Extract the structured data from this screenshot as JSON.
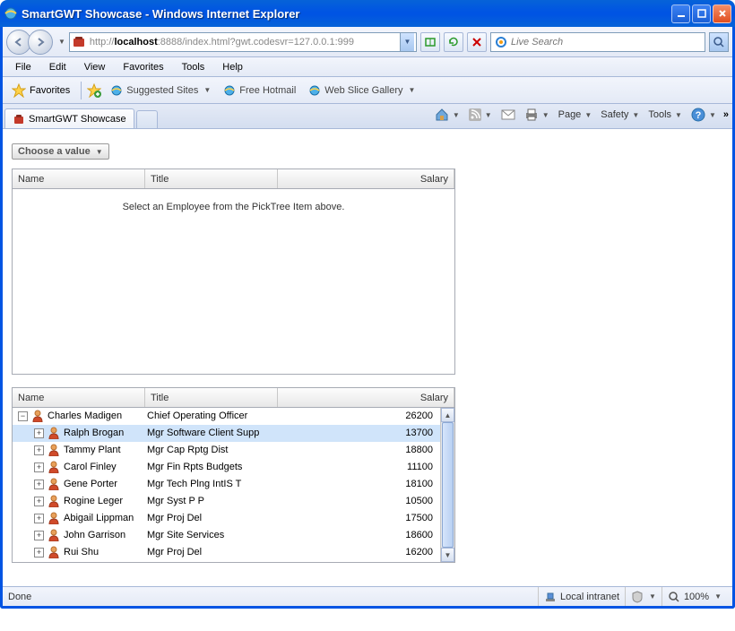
{
  "titlebar": {
    "text": "SmartGWT Showcase - Windows Internet Explorer"
  },
  "address": {
    "protocol": "http://",
    "host": "localhost",
    "rest": ":8888/index.html?gwt.codesvr=127.0.0.1:999"
  },
  "search": {
    "placeholder": "Live Search"
  },
  "menubar": [
    "File",
    "Edit",
    "View",
    "Favorites",
    "Tools",
    "Help"
  ],
  "favbar": {
    "favorites": "Favorites",
    "links": [
      "Suggested Sites",
      "Free Hotmail",
      "Web Slice Gallery"
    ]
  },
  "tab": {
    "label": "SmartGWT Showcase"
  },
  "tabtools": {
    "page": "Page",
    "safety": "Safety",
    "tools": "Tools"
  },
  "picker": {
    "label": "Choose a value"
  },
  "grid1": {
    "headers": {
      "name": "Name",
      "title": "Title",
      "salary": "Salary"
    },
    "empty": "Select an Employee from the PickTree Item above."
  },
  "grid2": {
    "headers": {
      "name": "Name",
      "title": "Title",
      "salary": "Salary"
    },
    "rows": [
      {
        "indent": 0,
        "expanded": true,
        "name": "Charles Madigen",
        "title": "Chief Operating Officer",
        "salary": "26200",
        "selected": false
      },
      {
        "indent": 1,
        "expanded": false,
        "name": "Ralph Brogan",
        "title": "Mgr Software Client Supp",
        "salary": "13700",
        "selected": true
      },
      {
        "indent": 1,
        "expanded": false,
        "name": "Tammy Plant",
        "title": "Mgr Cap Rptg Dist",
        "salary": "18800",
        "selected": false
      },
      {
        "indent": 1,
        "expanded": false,
        "name": "Carol Finley",
        "title": "Mgr Fin Rpts Budgets",
        "salary": "11100",
        "selected": false
      },
      {
        "indent": 1,
        "expanded": false,
        "name": "Gene Porter",
        "title": "Mgr Tech Plng IntIS T",
        "salary": "18100",
        "selected": false
      },
      {
        "indent": 1,
        "expanded": false,
        "name": "Rogine Leger",
        "title": "Mgr Syst P P",
        "salary": "10500",
        "selected": false
      },
      {
        "indent": 1,
        "expanded": false,
        "name": "Abigail Lippman",
        "title": "Mgr Proj Del",
        "salary": "17500",
        "selected": false
      },
      {
        "indent": 1,
        "expanded": false,
        "name": "John Garrison",
        "title": "Mgr Site Services",
        "salary": "18600",
        "selected": false
      },
      {
        "indent": 1,
        "expanded": false,
        "name": "Rui Shu",
        "title": "Mgr Proj Del",
        "salary": "16200",
        "selected": false
      }
    ]
  },
  "statusbar": {
    "done": "Done",
    "zone": "Local intranet",
    "zoom": "100%"
  }
}
